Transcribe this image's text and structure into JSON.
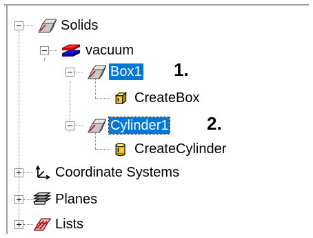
{
  "tree": {
    "solids": {
      "label": "Solids",
      "expanded": true,
      "icon": "solid-box-icon"
    },
    "vacuum": {
      "label": "vacuum",
      "icon": "material-layers-icon"
    },
    "box1": {
      "label": "Box1",
      "selected": true,
      "icon": "solid-box-icon"
    },
    "create_box": {
      "label": "CreateBox",
      "icon": "create-box-icon"
    },
    "cylinder1": {
      "label": "Cylinder1",
      "selected": true,
      "icon": "solid-box-icon"
    },
    "create_cylinder": {
      "label": "CreateCylinder",
      "icon": "create-cylinder-icon"
    },
    "coordinate_systems": {
      "label": "Coordinate Systems",
      "expanded": false,
      "icon": "axes-icon"
    },
    "planes": {
      "label": "Planes",
      "expanded": false,
      "icon": "planes-icon"
    },
    "lists": {
      "label": "Lists",
      "expanded": false,
      "icon": "lists-icon"
    }
  },
  "annotations": {
    "one": "1.",
    "two": "2."
  },
  "colors": {
    "selection": "#0078d7",
    "tree_line": "#808080"
  }
}
